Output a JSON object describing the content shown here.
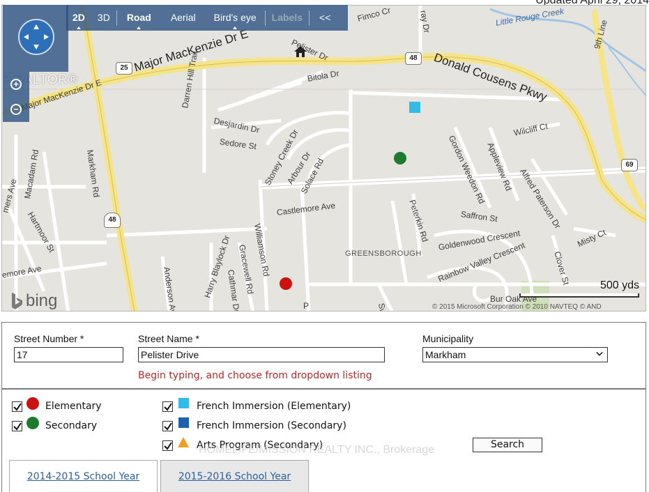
{
  "header": {
    "updated_text": "Updated April 29, 2014"
  },
  "map": {
    "toolbar": {
      "items": [
        {
          "label": "2D",
          "bold": true,
          "caret": true
        },
        {
          "label": "3D",
          "bold": false,
          "caret": false
        },
        {
          "label": "Road",
          "bold": true,
          "caret": true
        },
        {
          "label": "Aerial",
          "bold": false,
          "caret": false
        },
        {
          "label": "Bird's eye",
          "bold": false,
          "caret": true
        },
        {
          "label": "Labels",
          "bold": true,
          "caret": false,
          "dim": true
        },
        {
          "label": "<<",
          "bold": false,
          "caret": false
        }
      ]
    },
    "watermark_brand": "REALTOR®",
    "logo_text": "bing",
    "scale_label": "500 yds",
    "copyright": "© 2015 Microsoft Corporation   © 2010 NAVTEQ   © AND",
    "labels": {
      "major_mackenzie": "Major MacKenzie Dr E",
      "major_mackenzie_west": "Major MacKenzie Dr E",
      "donald_cousens": "Donald Cousens Pkwy",
      "little_rouge": "Little Rouge Creek",
      "ninth_line": "9th Line",
      "markham_rd": "Markham Rd",
      "pelister": "Pelister Dr",
      "fimco": "Fimco Cr",
      "bitola": "Bitola Dr",
      "darren_hill": "Darren Hill Trail",
      "desjardin": "Desjardin Dr",
      "sedore": "Sedore St",
      "stoney_creek": "Stoney Creek Dr",
      "arbour": "Arbour Dr",
      "solace": "Solace Rd",
      "castlemore": "Castlemore Ave",
      "gordon_weedon": "Gordon Weedon Rd",
      "appleview": "Appleview Rd",
      "wilcliff": "Wilcliff Ct",
      "alfred_paterson": "Alfred Paterson Dr",
      "peterkin": "Peterkin Rd",
      "saffron": "Saffron St",
      "goldenwood": "Goldenwood Crescent",
      "rainbow_valley": "Rainbow Valley Crescent",
      "clover": "Clover St",
      "misty": "Misty Ct",
      "greensborough": "GREENSBOROUGH",
      "williamson": "Williamson Rd",
      "gracewell": "Gracewell Rd",
      "cathmar": "Cathmar Dr",
      "harry_blaylock": "Harry Blaylock Dr",
      "anderson": "Anderson Ave",
      "macadam": "Macadam Rd",
      "hartmoor": "Hartmoor St",
      "mers": "mers Ave",
      "emore": "emore Ave",
      "bur_oak": "Bur Oak Ave",
      "ray": "ray Dr",
      "sw": "Swa",
      "p": "P"
    },
    "shields": [
      "25",
      "48",
      "48",
      "69"
    ]
  },
  "form": {
    "street_number_label": "Street Number *",
    "street_number_value": "17",
    "street_name_label": "Street Name *",
    "street_name_value": "Pelister Drive",
    "municipality_label": "Municipality",
    "municipality_value": "Markham",
    "hint": "Begin typing, and choose from dropdown listing"
  },
  "legend": {
    "elementary": "Elementary",
    "secondary": "Secondary",
    "french_elem": "French Immersion (Elementary)",
    "french_sec": "French Immersion (Secondary)",
    "arts": "Arts Program (Secondary)",
    "search_button": "Search",
    "colors": {
      "elementary": "#cc1111",
      "secondary": "#1e7a2e",
      "french_elem": "#33bbe6",
      "french_sec": "#1f5fb0",
      "arts": "#f0a020"
    }
  },
  "watermark": "HOMELIFE/MISSION REALTY INC., Brokerage",
  "tabs": [
    {
      "label": "2014-2015 School Year",
      "active": true
    },
    {
      "label": "2015-2016 School Year",
      "active": false
    }
  ]
}
